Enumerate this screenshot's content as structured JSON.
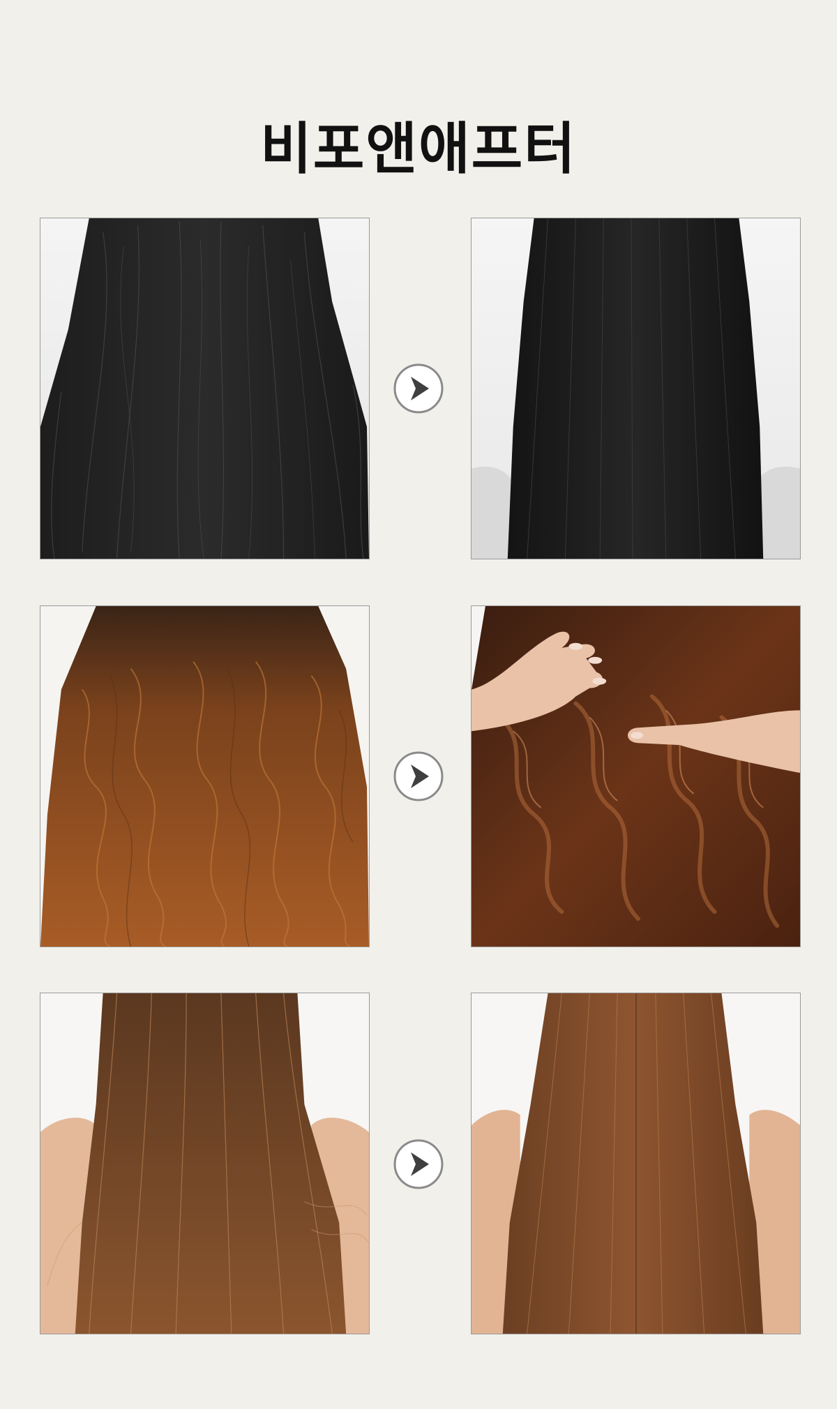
{
  "header": {
    "title": "비포앤애프터"
  },
  "comparisons": [
    {
      "before": {
        "image": "black-hair-frizzy-before"
      },
      "arrow": "chevron-right-icon",
      "after": {
        "image": "black-hair-straight-after"
      }
    },
    {
      "before": {
        "image": "auburn-hair-damaged-before"
      },
      "arrow": "chevron-right-icon",
      "after": {
        "image": "brown-hair-glossy-waves-after"
      }
    },
    {
      "before": {
        "image": "brown-hair-split-ends-before"
      },
      "arrow": "chevron-right-icon",
      "after": {
        "image": "brown-hair-sleek-straight-after"
      }
    }
  ],
  "colors": {
    "background": "#f2f0ea",
    "title": "#111111",
    "arrow_ring": "#8a8a8a",
    "arrow_fill": "#3f3f3f"
  }
}
